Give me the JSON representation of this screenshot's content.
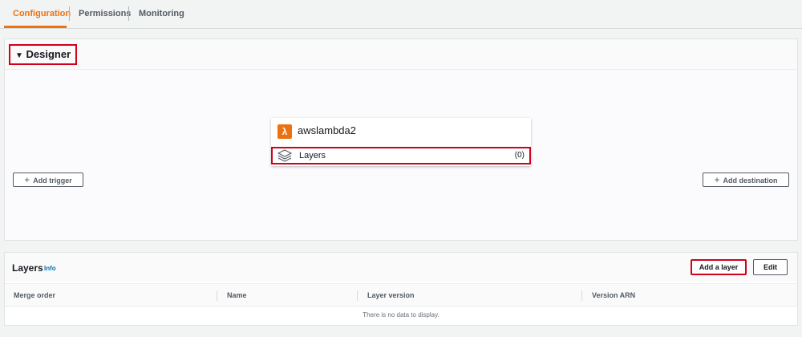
{
  "tabs": [
    {
      "label": "Configuration",
      "active": true
    },
    {
      "label": "Permissions",
      "active": false
    },
    {
      "label": "Monitoring",
      "active": false
    }
  ],
  "designer": {
    "toggle_icon": "caret-down-icon",
    "title": "Designer",
    "function_name": "awslambda2",
    "function_icon": "lambda-icon",
    "layers_label": "Layers",
    "layers_icon": "layers-icon",
    "layers_count": "(0)",
    "add_trigger_label": "Add trigger",
    "add_destination_label": "Add destination"
  },
  "layers_panel": {
    "title": "Layers",
    "info_link": "Info",
    "add_layer_label": "Add a layer",
    "edit_label": "Edit",
    "columns": [
      "Merge order",
      "Name",
      "Layer version",
      "Version ARN"
    ],
    "empty_message": "There is no data to display."
  },
  "colors": {
    "accent": "#ec7211",
    "highlight": "#d0021b",
    "link": "#0073bb"
  }
}
